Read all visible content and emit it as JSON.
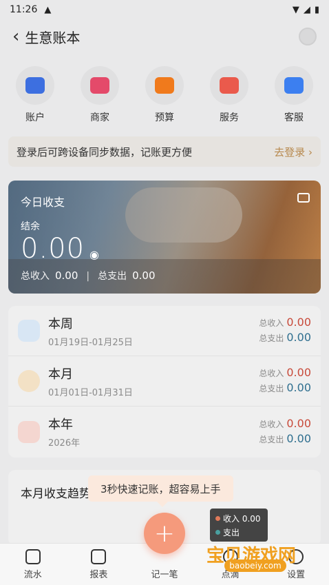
{
  "status_bar": {
    "time": "11:26"
  },
  "header": {
    "title": "生意账本"
  },
  "shortcuts": [
    {
      "label": "账户",
      "color": "#3d6fe0"
    },
    {
      "label": "商家",
      "color": "#e44a6a"
    },
    {
      "label": "预算",
      "color": "#f07a1c"
    },
    {
      "label": "服务",
      "color": "#ea5a4c"
    },
    {
      "label": "客服",
      "color": "#3c7ff0"
    }
  ],
  "banner": {
    "text": "登录后可跨设备同步数据，记账更方便",
    "action": "去登录 ›"
  },
  "today": {
    "title": "今日收支",
    "balance_label": "结余",
    "balance": "0.00",
    "income_label": "总收入",
    "income": "0.00",
    "expense_label": "总支出",
    "expense": "0.00"
  },
  "periods": [
    {
      "name": "本周",
      "range": "01月19日-01月25日",
      "income_label": "总收入",
      "income": "0.00",
      "expense_label": "总支出",
      "expense": "0.00"
    },
    {
      "name": "本月",
      "range": "01月01日-01月31日",
      "income_label": "总收入",
      "income": "0.00",
      "expense_label": "总支出",
      "expense": "0.00"
    },
    {
      "name": "本年",
      "range": "2026年",
      "income_label": "总收入",
      "income": "0.00",
      "expense_label": "总支出",
      "expense": "0.00"
    }
  ],
  "trend": {
    "title": "本月收支趋势"
  },
  "tooltip": {
    "text": "3秒快速记账，超容易上手"
  },
  "legend": {
    "income": "收入 0.00",
    "expense": "支出"
  },
  "tabbar": {
    "items": [
      "流水",
      "报表",
      "记一笔",
      "点滴",
      "设置"
    ],
    "fab": "+"
  },
  "watermark": {
    "title": "宝贝游戏网",
    "url": "baobeiy.com"
  }
}
